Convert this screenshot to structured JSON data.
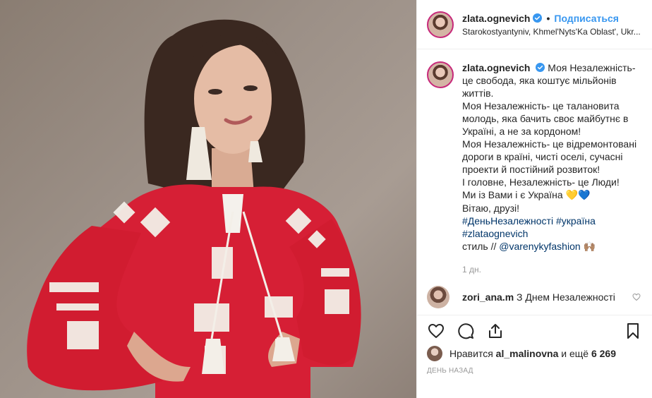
{
  "header": {
    "username": "zlata.ognevich",
    "separator": "•",
    "follow_label": "Подписаться",
    "location": "Starokostyantyniv, Khmel'Nyts'Ka Oblast', Ukr..."
  },
  "caption": {
    "username": "zlata.ognevich",
    "text_1": "Моя Незалежність- це свобода, яка коштує мільйонів життів.",
    "text_2": "Моя Незалежність- це талановита молодь, яка бачить своє майбутнє в Україні, а не за кордоном!",
    "text_3": "Моя Незалежність- це відремонтовані дороги в країні, чисті оселі, сучасні проекти й постійний розвиток!",
    "text_4": "І головне, Незалежність- це Люди!",
    "text_5": "Ми із Вами і є Україна",
    "hearts": "💛💙",
    "text_6": "Вітаю, друзі!",
    "hashtag_1": "#ДеньНезалежності",
    "hashtag_2": "#україна",
    "hashtag_3": "#zlataognevich",
    "style_prefix": "стиль //",
    "mention": "@varenykyfashion",
    "hands_emoji": "🙌🏽"
  },
  "time_ago": "1 дн.",
  "comment": {
    "username": "zori_ana.m",
    "text": "З Днем Незалежності"
  },
  "likes": {
    "prefix": "Нравится",
    "user": "al_malinovna",
    "middle": "и ещё",
    "count": "6 269"
  },
  "posted": "ДЕНЬ НАЗАД",
  "icons": {
    "like": "heart-icon",
    "comment": "comment-icon",
    "share": "share-icon",
    "save": "bookmark-icon",
    "verified": "verified-badge-icon"
  },
  "colors": {
    "link": "#3897f0",
    "hashtag": "#003569",
    "verified": "#3897f0",
    "dress": "#d61f35"
  }
}
